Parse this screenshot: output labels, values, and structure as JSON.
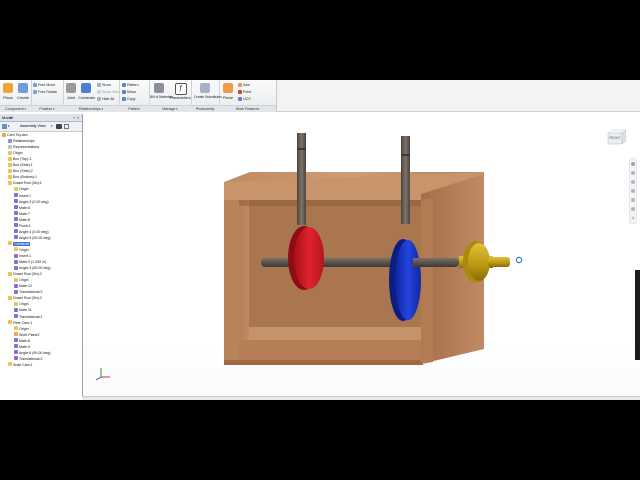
{
  "ribbon": {
    "panels": [
      {
        "title": "Component",
        "buttons": [
          {
            "label": "Place",
            "icon": "place-icon",
            "color": "#f0a43a"
          },
          {
            "label": "Create",
            "icon": "create-icon",
            "color": "#6d9ed8"
          }
        ]
      },
      {
        "title": "Position",
        "buttons": [
          {
            "label": "Joint",
            "icon": "joint-icon",
            "color": "#9a9a9a"
          },
          {
            "label": "Constrain",
            "icon": "constrain-icon",
            "color": "#4f7fcf"
          }
        ],
        "small": [
          {
            "label": "Free Move",
            "icon": "free-move-icon"
          },
          {
            "label": "Free Rotate",
            "icon": "free-rotate-icon"
          }
        ]
      },
      {
        "title": "Relationships",
        "small": [
          {
            "label": "Show",
            "icon": "show-icon"
          },
          {
            "label": "Show Sick",
            "icon": "show-sick-icon"
          },
          {
            "label": "Hide All",
            "icon": "hide-all-icon"
          }
        ]
      },
      {
        "title": "Pattern",
        "small": [
          {
            "label": "Pattern",
            "icon": "pattern-icon"
          },
          {
            "label": "Mirror",
            "icon": "mirror-icon"
          },
          {
            "label": "Copy",
            "icon": "copy-icon"
          }
        ]
      },
      {
        "title": "Manage",
        "buttons": [
          {
            "label": "Bill of Materials",
            "icon": "bom-icon",
            "color": "#8a8fa0"
          },
          {
            "label": "Parameters",
            "icon": "parameters-icon",
            "color": "#555"
          }
        ]
      },
      {
        "title": "Productivity",
        "buttons": [
          {
            "label": "Create Substitutes",
            "icon": "substitutes-icon",
            "color": "#a7b3c4"
          }
        ]
      },
      {
        "title": "Work Features",
        "buttons": [
          {
            "label": "Plane",
            "icon": "plane-icon",
            "color": "#f29a46"
          }
        ],
        "small": [
          {
            "label": "Axis",
            "icon": "axis-icon"
          },
          {
            "label": "Point",
            "icon": "point-icon"
          },
          {
            "label": "UCS",
            "icon": "ucs-icon"
          }
        ]
      }
    ]
  },
  "browser": {
    "title": "Model",
    "view_label": "Assembly View",
    "tree": [
      {
        "label": "Cam Toy.iam",
        "level": 0,
        "icon": "assembly-icon"
      },
      {
        "label": "Relationships",
        "level": 1,
        "icon": "relationships-icon"
      },
      {
        "label": "Representations",
        "level": 1,
        "icon": "representations-icon"
      },
      {
        "label": "Origin",
        "level": 1,
        "icon": "folder-icon"
      },
      {
        "label": "Box (Top):1",
        "level": 1,
        "icon": "part-icon"
      },
      {
        "label": "Box (Side):1",
        "level": 1,
        "icon": "part-icon"
      },
      {
        "label": "Box (Side):2",
        "level": 1,
        "icon": "part-icon"
      },
      {
        "label": "Box (Bottom):1",
        "level": 1,
        "icon": "part-icon"
      },
      {
        "label": "Dowel Rod (3in):1",
        "level": 1,
        "icon": "part-icon"
      },
      {
        "label": "Origin",
        "level": 2,
        "icon": "folder-icon"
      },
      {
        "label": "Insert:1",
        "level": 2,
        "icon": "constraint-icon"
      },
      {
        "label": "Angle:3 (0.00 deg)",
        "level": 2,
        "icon": "constraint-icon"
      },
      {
        "label": "Mate:6",
        "level": 2,
        "icon": "constraint-icon"
      },
      {
        "label": "Mate:7",
        "level": 2,
        "icon": "constraint-icon"
      },
      {
        "label": "Mate:8",
        "level": 2,
        "icon": "constraint-icon"
      },
      {
        "label": "Flush:1",
        "level": 2,
        "icon": "constraint-icon"
      },
      {
        "label": "Angle:4 (0.00 deg)",
        "level": 2,
        "icon": "constraint-icon"
      },
      {
        "label": "Angle:5 (90.00 deg)",
        "level": 2,
        "icon": "constraint-icon"
      },
      {
        "label": "Camshaft",
        "level": 1,
        "icon": "part-icon",
        "selected": true
      },
      {
        "label": "Origin",
        "level": 2,
        "icon": "folder-icon"
      },
      {
        "label": "Insert:1",
        "level": 2,
        "icon": "constraint-icon"
      },
      {
        "label": "Mate:3 (1.299 in)",
        "level": 2,
        "icon": "constraint-icon"
      },
      {
        "label": "Angle:3 (90.00 deg)",
        "level": 2,
        "icon": "constraint-icon"
      },
      {
        "label": "Dowel Rod (3in):2",
        "level": 1,
        "icon": "part-icon"
      },
      {
        "label": "Origin",
        "level": 2,
        "icon": "folder-icon"
      },
      {
        "label": "Mate:12",
        "level": 2,
        "icon": "constraint-icon"
      },
      {
        "label": "Translational:2",
        "level": 2,
        "icon": "constraint-icon"
      },
      {
        "label": "Dowel Rod (3in):2",
        "level": 1,
        "icon": "part-icon"
      },
      {
        "label": "Origin",
        "level": 2,
        "icon": "folder-icon"
      },
      {
        "label": "Mate:11",
        "level": 2,
        "icon": "constraint-icon"
      },
      {
        "label": "Translational:1",
        "level": 2,
        "icon": "constraint-icon"
      },
      {
        "label": "Pear Cam:1",
        "level": 1,
        "icon": "part-icon"
      },
      {
        "label": "Origin",
        "level": 2,
        "icon": "folder-icon"
      },
      {
        "label": "Work Plane2",
        "level": 2,
        "icon": "workplane-icon"
      },
      {
        "label": "Mate:8",
        "level": 2,
        "icon": "constraint-icon"
      },
      {
        "label": "Mate:9",
        "level": 2,
        "icon": "constraint-icon"
      },
      {
        "label": "Angle:6 (90.00 deg)",
        "level": 2,
        "icon": "constraint-icon"
      },
      {
        "label": "Translational:2",
        "level": 2,
        "icon": "constraint-icon"
      },
      {
        "label": "Snail Cam:1",
        "level": 1,
        "icon": "part-icon"
      }
    ]
  },
  "viewport": {
    "viewcube_label": "FRONT",
    "colors": {
      "wood": "#b7825c",
      "red_cam": "#d01a25",
      "blue_cam": "#1736c8",
      "follower": "#c8a416",
      "rod": "#5d574f"
    }
  }
}
